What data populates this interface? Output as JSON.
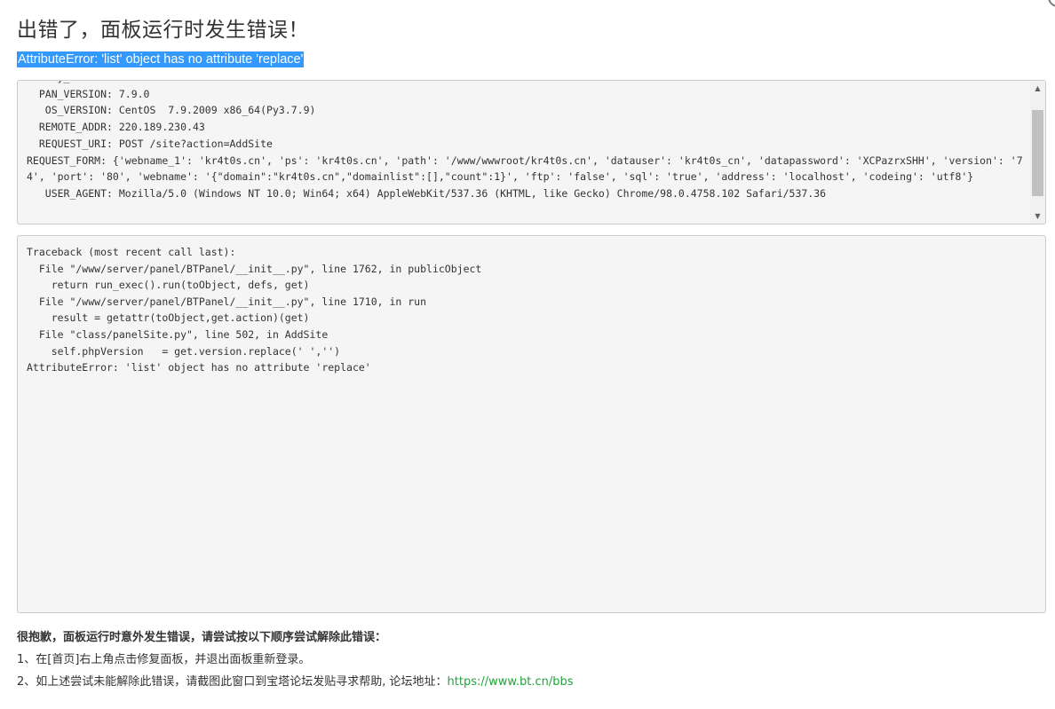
{
  "header": {
    "title": "出错了，面板运行时发生错误！",
    "error_message": "AttributeError: 'list' object has no attribute 'replace'"
  },
  "request_info": {
    "text": "    Py_ENV: ...\n  PAN_VERSION: 7.9.0\n   OS_VERSION: CentOS  7.9.2009 x86_64(Py3.7.9)\n  REMOTE_ADDR: 220.189.230.43\n  REQUEST_URI: POST /site?action=AddSite\nREQUEST_FORM: {'webname_1': 'kr4t0s.cn', 'ps': 'kr4t0s.cn', 'path': '/www/wwwroot/kr4t0s.cn', 'datauser': 'kr4t0s_cn', 'datapassword': 'XCPazrxSHH', 'version': '74', 'port': '80', 'webname': '{\"domain\":\"kr4t0s.cn\",\"domainlist\":[],\"count\":1}', 'ftp': 'false', 'sql': 'true', 'address': 'localhost', 'codeing': 'utf8'}\n   USER_AGENT: Mozilla/5.0 (Windows NT 10.0; Win64; x64) AppleWebKit/537.36 (KHTML, like Gecko) Chrome/98.0.4758.102 Safari/537.36"
  },
  "scrollbar": {
    "up_icon": "▲",
    "down_icon": "▼"
  },
  "traceback": {
    "text": "Traceback (most recent call last):\n  File \"/www/server/panel/BTPanel/__init__.py\", line 1762, in publicObject\n    return run_exec().run(toObject, defs, get)\n  File \"/www/server/panel/BTPanel/__init__.py\", line 1710, in run\n    result = getattr(toObject,get.action)(get)\n  File \"class/panelSite.py\", line 502, in AddSite\n    self.phpVersion   = get.version.replace(' ','')\nAttributeError: 'list' object has no attribute 'replace'"
  },
  "help": {
    "heading": "很抱歉，面板运行时意外发生错误，请尝试按以下顺序尝试解除此错误：",
    "step1": "1、在[首页]右上角点击修复面板，并退出面板重新登录。",
    "step2": "2、如上述尝试未能解除此错误，请截图此窗口到宝塔论坛发贴寻求帮助, 论坛地址：",
    "forum_link": "https://www.bt.cn/bbs"
  },
  "colors": {
    "selection_highlight": "#3399ff",
    "link": "#20a53a"
  }
}
